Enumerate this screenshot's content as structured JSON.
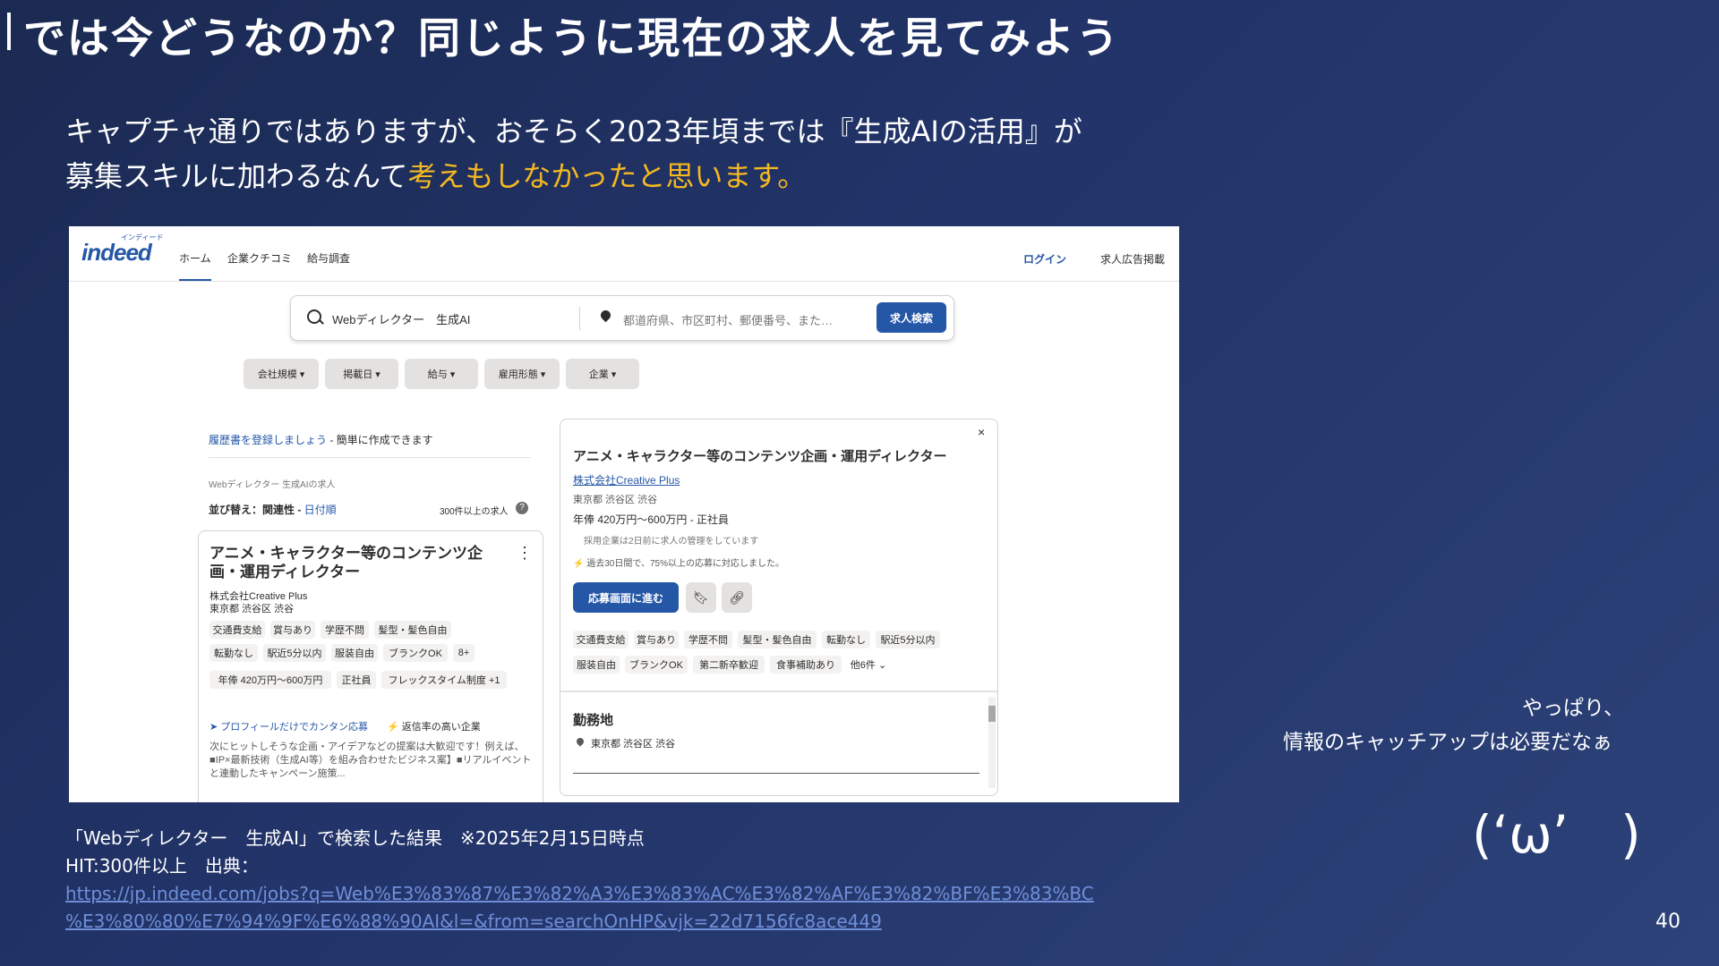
{
  "slide": {
    "title": "では今どうなのか？同じように現在の求人を見てみよう",
    "intro_line1": "キャプチャ通りではありますが、おそらく2023年頃までは『生成AIの活用』が",
    "intro_line2_plain": "募集スキルに加わるなんて",
    "intro_line2_highlight": "考えもしなかったと思います。",
    "highlight_color": "#f5b820",
    "page_number": "40"
  },
  "screenshot": {
    "logo": "indeed",
    "logo_sub": "インディード",
    "nav": [
      "ホーム",
      "企業クチコミ",
      "給与調査"
    ],
    "login": "ログイン",
    "employer": "求人広告掲載",
    "search": {
      "what": "Webディレクター　生成AI",
      "where_placeholder": "都道府県、市区町村、郵便番号、また…",
      "button": "求人検索"
    },
    "filters": [
      "会社規模",
      "掲載日",
      "給与",
      "雇用形態",
      "企業"
    ],
    "resume_link": "履歴書を登録しましょう",
    "resume_rest": " - 簡単に作成できます",
    "result_label": "Webディレクター 生成AIの求人",
    "sort_label": "並び替え：関連性 - ",
    "sort_alt": "日付順",
    "count": "300件以上の求人",
    "card": {
      "title": "アニメ・キャラクター等のコンテンツ企画・運用ディレクター",
      "company": "株式会社Creative Plus",
      "location": "東京都 渋谷区 渋谷",
      "tags_row1": [
        "交通費支給",
        "賞与あり",
        "学歴不問",
        "髪型・髪色自由"
      ],
      "tags_row2": [
        "転勤なし",
        "駅近5分以内",
        "服装自由",
        "ブランクOK",
        "8+"
      ],
      "tags_row3": [
        "年俸 420万円～600万円",
        "正社員",
        "フレックスタイム制度 +1"
      ],
      "feature1": "プロフィールだけでカンタン応募",
      "feature2": "返信率の高い企業",
      "desc": "次にヒットしそうな企画・アイデアなどの提案は大歓迎です！例えば、■IP×最新技術（生成AI等）を組み合わせたビジネス案】■リアルイベントと連動したキャンペーン施策..."
    },
    "detail": {
      "close": "×",
      "title": "アニメ・キャラクター等のコンテンツ企画・運用ディレクター",
      "company": "株式会社Creative Plus",
      "location": "東京都 渋谷区 渋谷",
      "salary": "年俸 420万円～600万円 - 正社員",
      "note1": "採用企業は2日前に求人の管理をしています",
      "note2_bold": "⚡",
      "note2": " 過去30日間で、75%以上の応募に対応しました。",
      "apply": "応募画面に進む",
      "tags_row1": [
        "交通費支給",
        "賞与あり",
        "学歴不問",
        "髪型・髪色自由",
        "転勤なし",
        "駅近5分以内"
      ],
      "tags_row2": [
        "服装自由",
        "ブランクOK",
        "第二新卒歓迎",
        "食事補助あり",
        "他6件 ⌄"
      ],
      "section": "勤務地",
      "address": "東京都 渋谷区 渋谷"
    }
  },
  "caption": {
    "line1": "「Webディレクター　生成AI」で検索した結果　※2025年2月15日時点",
    "line2": "HIT:300件以上　出典：",
    "url1": "https://jp.indeed.com/jobs?q=Web%E3%83%87%E3%82%A3%E3%83%AC%E3%82%AF%E3%82%BF%E3%83%BC",
    "url2": "%E3%80%80%E7%94%9F%E6%88%90AI&l=&from=searchOnHP&vjk=22d7156fc8ace449"
  },
  "aside": {
    "line1": "やっぱり、",
    "line2": "情報のキャッチアップは必要だなぁ",
    "face": "(‘ω’　)"
  }
}
